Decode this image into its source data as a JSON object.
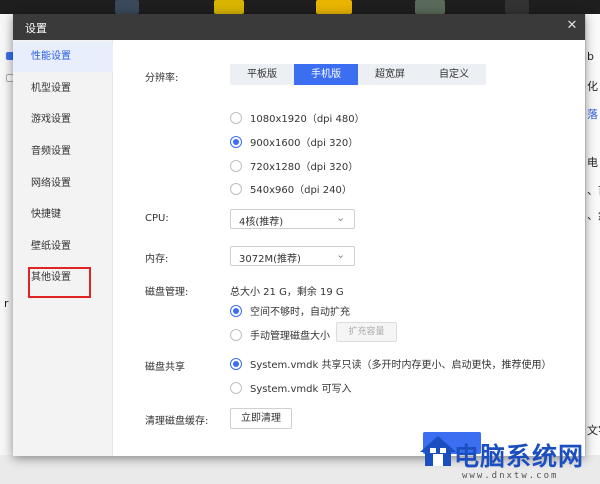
{
  "background": {
    "right_fragments": [
      "b",
      "化",
      "落",
      "电",
      "、首",
      "、然",
      "文字"
    ],
    "left_fragment": "r"
  },
  "dialog": {
    "title": "设置",
    "close_icon": "close-icon"
  },
  "sidebar": {
    "items": [
      {
        "label": "性能设置",
        "active": true
      },
      {
        "label": "机型设置",
        "active": false
      },
      {
        "label": "游戏设置",
        "active": false
      },
      {
        "label": "音频设置",
        "active": false
      },
      {
        "label": "网络设置",
        "active": false
      },
      {
        "label": "快捷键",
        "active": false
      },
      {
        "label": "壁纸设置",
        "active": false
      },
      {
        "label": "其他设置",
        "active": false
      }
    ]
  },
  "performance": {
    "resolution_label": "分辨率:",
    "resolution_tabs": [
      {
        "label": "平板版",
        "active": false
      },
      {
        "label": "手机版",
        "active": true
      },
      {
        "label": "超宽屏",
        "active": false
      },
      {
        "label": "自定义",
        "active": false
      }
    ],
    "resolution_options": [
      {
        "label": "1080x1920（dpi 480）",
        "selected": false
      },
      {
        "label": "900x1600（dpi 320）",
        "selected": true
      },
      {
        "label": "720x1280（dpi 320）",
        "selected": false
      },
      {
        "label": "540x960（dpi 240）",
        "selected": false
      }
    ],
    "cpu_label": "CPU:",
    "cpu_value": "4核(推荐)",
    "memory_label": "内存:",
    "memory_value": "3072M(推荐)",
    "disk_label": "磁盘管理:",
    "disk_info": "总大小 21 G，剩余 19 G",
    "disk_options": [
      {
        "label": "空间不够时，自动扩充",
        "selected": true
      },
      {
        "label": "手动管理磁盘大小",
        "selected": false
      }
    ],
    "expand_button": "扩充容量",
    "share_label": "磁盘共享",
    "share_options": [
      {
        "label": "System.vmdk 共享只读（多开时内存更小、启动更快，推荐使用）",
        "selected": true
      },
      {
        "label": "System.vmdk 可写入",
        "selected": false
      }
    ],
    "clear_cache_label": "清理磁盘缓存:",
    "clear_cache_button": "立即清理"
  },
  "watermark": {
    "text": "电脑系统网",
    "url": "www.dnxtw.com"
  },
  "colors": {
    "accent": "#3b6ef0",
    "titlebar": "#3a3a3a",
    "highlight": "#e02424",
    "watermark": "#1b4fbf"
  }
}
